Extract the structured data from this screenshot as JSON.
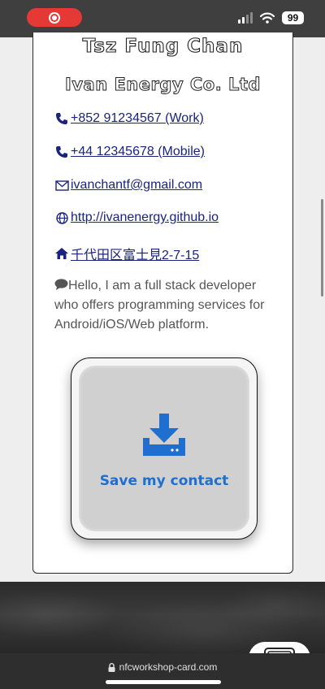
{
  "status_bar": {
    "battery": "99"
  },
  "profile": {
    "name": "Tsz Fung Chan",
    "company": "Ivan Energy Co. Ltd"
  },
  "contacts": [
    {
      "icon": "phone-icon",
      "text": " +852 91234567 (Work)"
    },
    {
      "icon": "phone-icon",
      "text": "+44 12345678 (Mobile)"
    },
    {
      "icon": "mail-icon",
      "text": " ivanchantf@gmail.com"
    },
    {
      "icon": "globe-icon",
      "text": "http://ivanenergy.github.io"
    },
    {
      "icon": "home-icon",
      "text": " 千代田区富士見2-7-15"
    }
  ],
  "bio": "Hello, I am a full stack developer who offers programming services for Android/iOS/Web platform.",
  "save_button": {
    "label": "Save my contact",
    "icon": "download-icon"
  },
  "browser": {
    "url": "nfcworkshop-card.com"
  },
  "colors": {
    "link": "#1a237e",
    "accent_blue": "#1e6fd0",
    "record_red": "#e53935"
  }
}
